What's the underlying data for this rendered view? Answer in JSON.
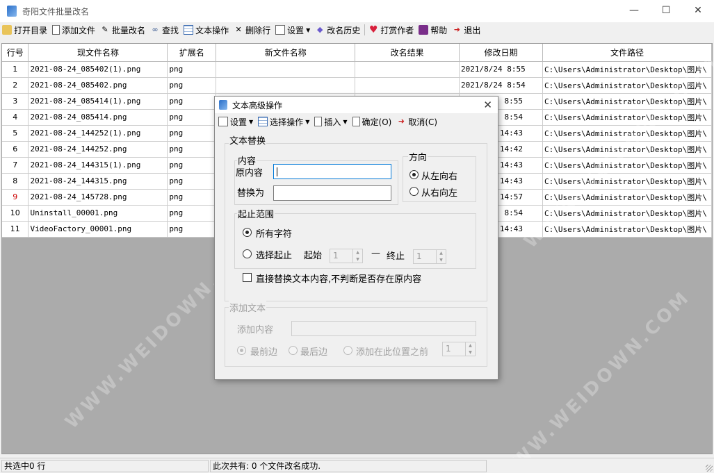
{
  "window": {
    "title": "奇阳文件批量改名",
    "minimize": "—",
    "maximize": "☐",
    "close": "✕"
  },
  "toolbar": {
    "open_dir": "打开目录",
    "add_file": "添加文件",
    "batch_rename": "批量改名",
    "find": "查找",
    "text_ops": "文本操作",
    "delete_row": "删除行",
    "settings": "设置",
    "history": "改名历史",
    "reward": "打赏作者",
    "help": "帮助",
    "exit": "退出"
  },
  "grid": {
    "headers": [
      "行号",
      "现文件名称",
      "扩展名",
      "新文件名称",
      "改名结果",
      "修改日期",
      "文件路径"
    ],
    "rows": [
      {
        "n": "1",
        "name": "2021-08-24_085402(1).png",
        "ext": "png",
        "date": "2021/8/24 8:55",
        "path": "C:\\Users\\Administrator\\Desktop\\图片\\"
      },
      {
        "n": "2",
        "name": "2021-08-24_085402.png",
        "ext": "png",
        "date": "2021/8/24 8:54",
        "path": "C:\\Users\\Administrator\\Desktop\\图片\\"
      },
      {
        "n": "3",
        "name": "2021-08-24_085414(1).png",
        "ext": "png",
        "date": "8:55",
        "path": "C:\\Users\\Administrator\\Desktop\\图片\\"
      },
      {
        "n": "4",
        "name": "2021-08-24_085414.png",
        "ext": "png",
        "date": "8:54",
        "path": "C:\\Users\\Administrator\\Desktop\\图片\\"
      },
      {
        "n": "5",
        "name": "2021-08-24_144252(1).png",
        "ext": "png",
        "date": "14:43",
        "path": "C:\\Users\\Administrator\\Desktop\\图片\\"
      },
      {
        "n": "6",
        "name": "2021-08-24_144252.png",
        "ext": "png",
        "date": "14:42",
        "path": "C:\\Users\\Administrator\\Desktop\\图片\\"
      },
      {
        "n": "7",
        "name": "2021-08-24_144315(1).png",
        "ext": "png",
        "date": "14:43",
        "path": "C:\\Users\\Administrator\\Desktop\\图片\\"
      },
      {
        "n": "8",
        "name": "2021-08-24_144315.png",
        "ext": "png",
        "date": "14:43",
        "path": "C:\\Users\\Administrator\\Desktop\\图片\\"
      },
      {
        "n": "9",
        "name": "2021-08-24_145728.png",
        "ext": "png",
        "date": "14:57",
        "path": "C:\\Users\\Administrator\\Desktop\\图片\\"
      },
      {
        "n": "10",
        "name": "Uninstall_00001.png",
        "ext": "png",
        "date": "8:54",
        "path": "C:\\Users\\Administrator\\Desktop\\图片\\"
      },
      {
        "n": "11",
        "name": "VideoFactory_00001.png",
        "ext": "png",
        "date": "14:43",
        "path": "C:\\Users\\Administrator\\Desktop\\图片\\"
      }
    ]
  },
  "status": {
    "selected": "共选中0 行",
    "message": "此次共有: 0 个文件改名成功."
  },
  "dialog": {
    "title": "文本高级操作",
    "close": "✕",
    "toolbar": {
      "settings": "设置",
      "select_op": "选择操作",
      "insert": "插入",
      "ok": "确定(O)",
      "cancel": "取消(C)"
    },
    "replace_group": "文本替换",
    "content_group": "内容",
    "original_label": "原内容",
    "replace_label": "替换为",
    "direction_group": "方向",
    "left_to_right": "从左向右",
    "right_to_left": "从右向左",
    "range_group": "起止范围",
    "all_chars": "所有字符",
    "select_range": "选择起止",
    "start_label": "起始",
    "start_value": "1",
    "dash": "—",
    "end_label": "终止",
    "end_value": "1",
    "direct_replace": "直接替换文本内容,不判断是否存在原内容",
    "add_group": "添加文本",
    "add_content_label": "添加内容",
    "at_front": "最前边",
    "at_back": "最后边",
    "at_position": "添加在此位置之前",
    "position_value": "1"
  }
}
